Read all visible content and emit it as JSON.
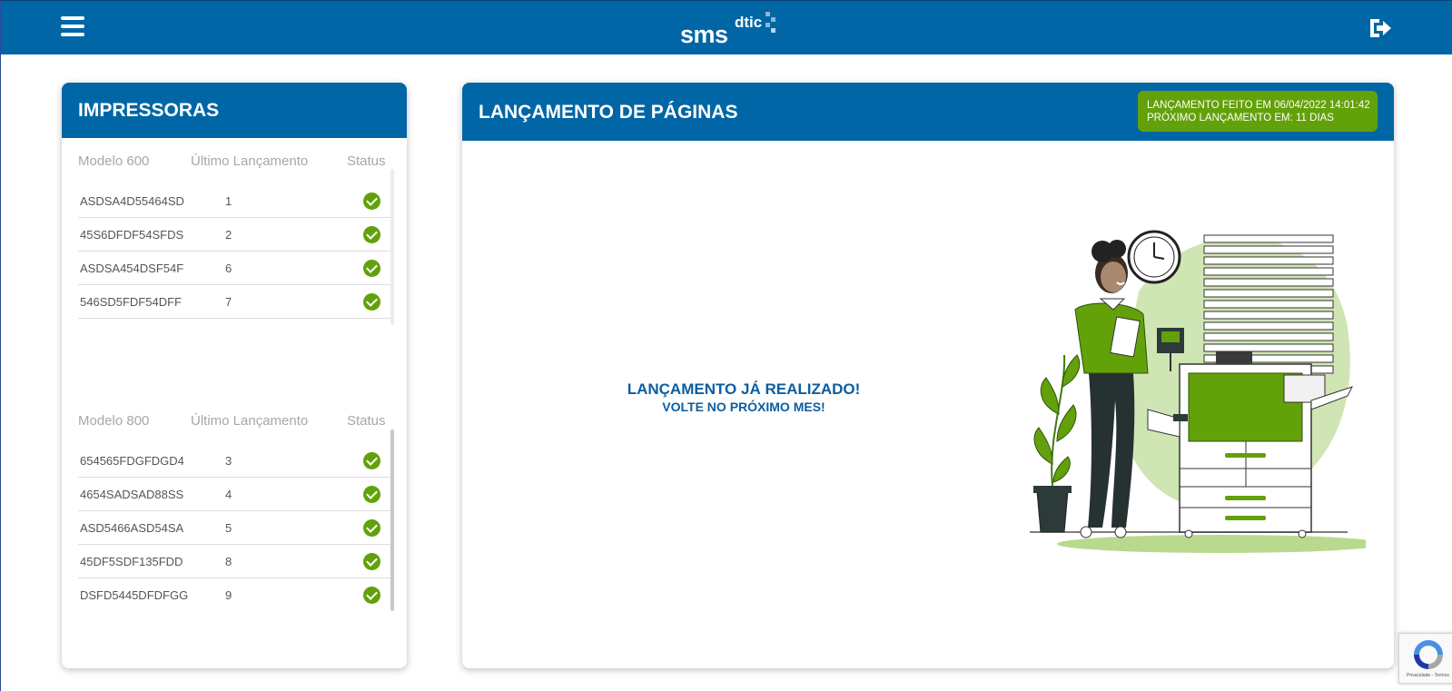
{
  "header": {
    "logo_main": "sms",
    "logo_sup": "dtic",
    "menu_icon": "hamburger-menu-icon",
    "logout_icon": "logout-icon",
    "background_color": "#0066a6"
  },
  "printers_panel": {
    "title": "IMPRESSORAS",
    "groups": [
      {
        "model": "Modelo 600",
        "col_last": "Último Lançamento",
        "col_status": "Status",
        "rows": [
          {
            "serial": "ASDSA4D55464SD",
            "last": "1",
            "status_icon": "check-circle-icon"
          },
          {
            "serial": "45S6DFDF54SFDS",
            "last": "2",
            "status_icon": "check-circle-icon"
          },
          {
            "serial": "ASDSA454DSF54F",
            "last": "6",
            "status_icon": "check-circle-icon"
          },
          {
            "serial": "546SD5FDF54DFF",
            "last": "7",
            "status_icon": "check-circle-icon"
          }
        ]
      },
      {
        "model": "Modelo 800",
        "col_last": "Último Lançamento",
        "col_status": "Status",
        "rows": [
          {
            "serial": "654565FDGFDGD4",
            "last": "3",
            "status_icon": "check-circle-icon"
          },
          {
            "serial": "4654SADSAD88SS",
            "last": "4",
            "status_icon": "check-circle-icon"
          },
          {
            "serial": "ASD5466ASD54SA",
            "last": "5",
            "status_icon": "check-circle-icon"
          },
          {
            "serial": "45DF5SDF135FDD",
            "last": "8",
            "status_icon": "check-circle-icon"
          },
          {
            "serial": "DSFD5445DFDFGG",
            "last": "9",
            "status_icon": "check-circle-icon"
          }
        ]
      }
    ]
  },
  "main_panel": {
    "title": "LANÇAMENTO DE PÁGINAS",
    "badge_line1": "LANÇAMENTO FEITO EM 06/04/2022 14:01:42",
    "badge_line2": "PRÓXIMO LANÇAMENTO EM: 11 DIAS",
    "badge_color": "#62a10a",
    "message_line1": "LANÇAMENTO JÁ REALIZADO!",
    "message_line2": "VOLTE NO PRÓXIMO MES!",
    "message_color": "#0b5d9f"
  },
  "recaptcha": {
    "text": "Privacidade - Termos",
    "icon": "recaptcha-icon"
  }
}
